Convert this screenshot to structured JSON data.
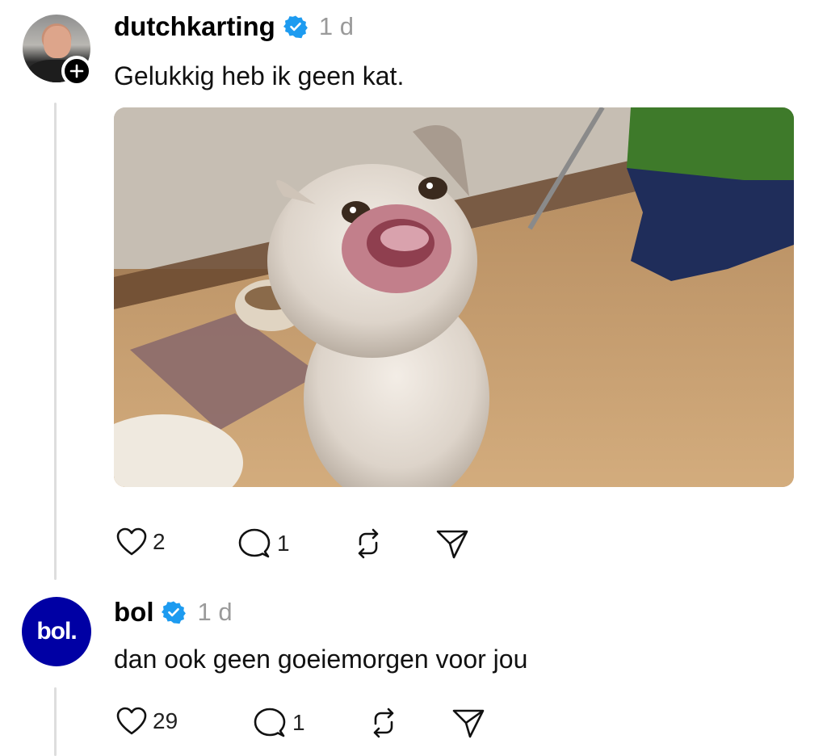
{
  "post1": {
    "username": "dutchkarting",
    "verified": true,
    "timestamp": "1 d",
    "text": "Gelukkig heb ik geen kat.",
    "media": "cat-image",
    "likes": "2",
    "replies": "1",
    "avatar_badge": "plus-icon"
  },
  "post2": {
    "username": "bol",
    "verified": true,
    "timestamp": "1 d",
    "text": "dan ook geen goeiemorgen voor jou",
    "avatar_logo": "bol.",
    "likes": "29",
    "replies": "1"
  },
  "colors": {
    "verified_blue": "#1d9bf0",
    "bol_brand": "#0000a4",
    "muted_text": "#9a9a9a",
    "thread_line": "#dddddd"
  },
  "icons": [
    "heart-icon",
    "comment-icon",
    "repost-icon",
    "share-icon",
    "verified-badge-icon",
    "plus-icon"
  ]
}
